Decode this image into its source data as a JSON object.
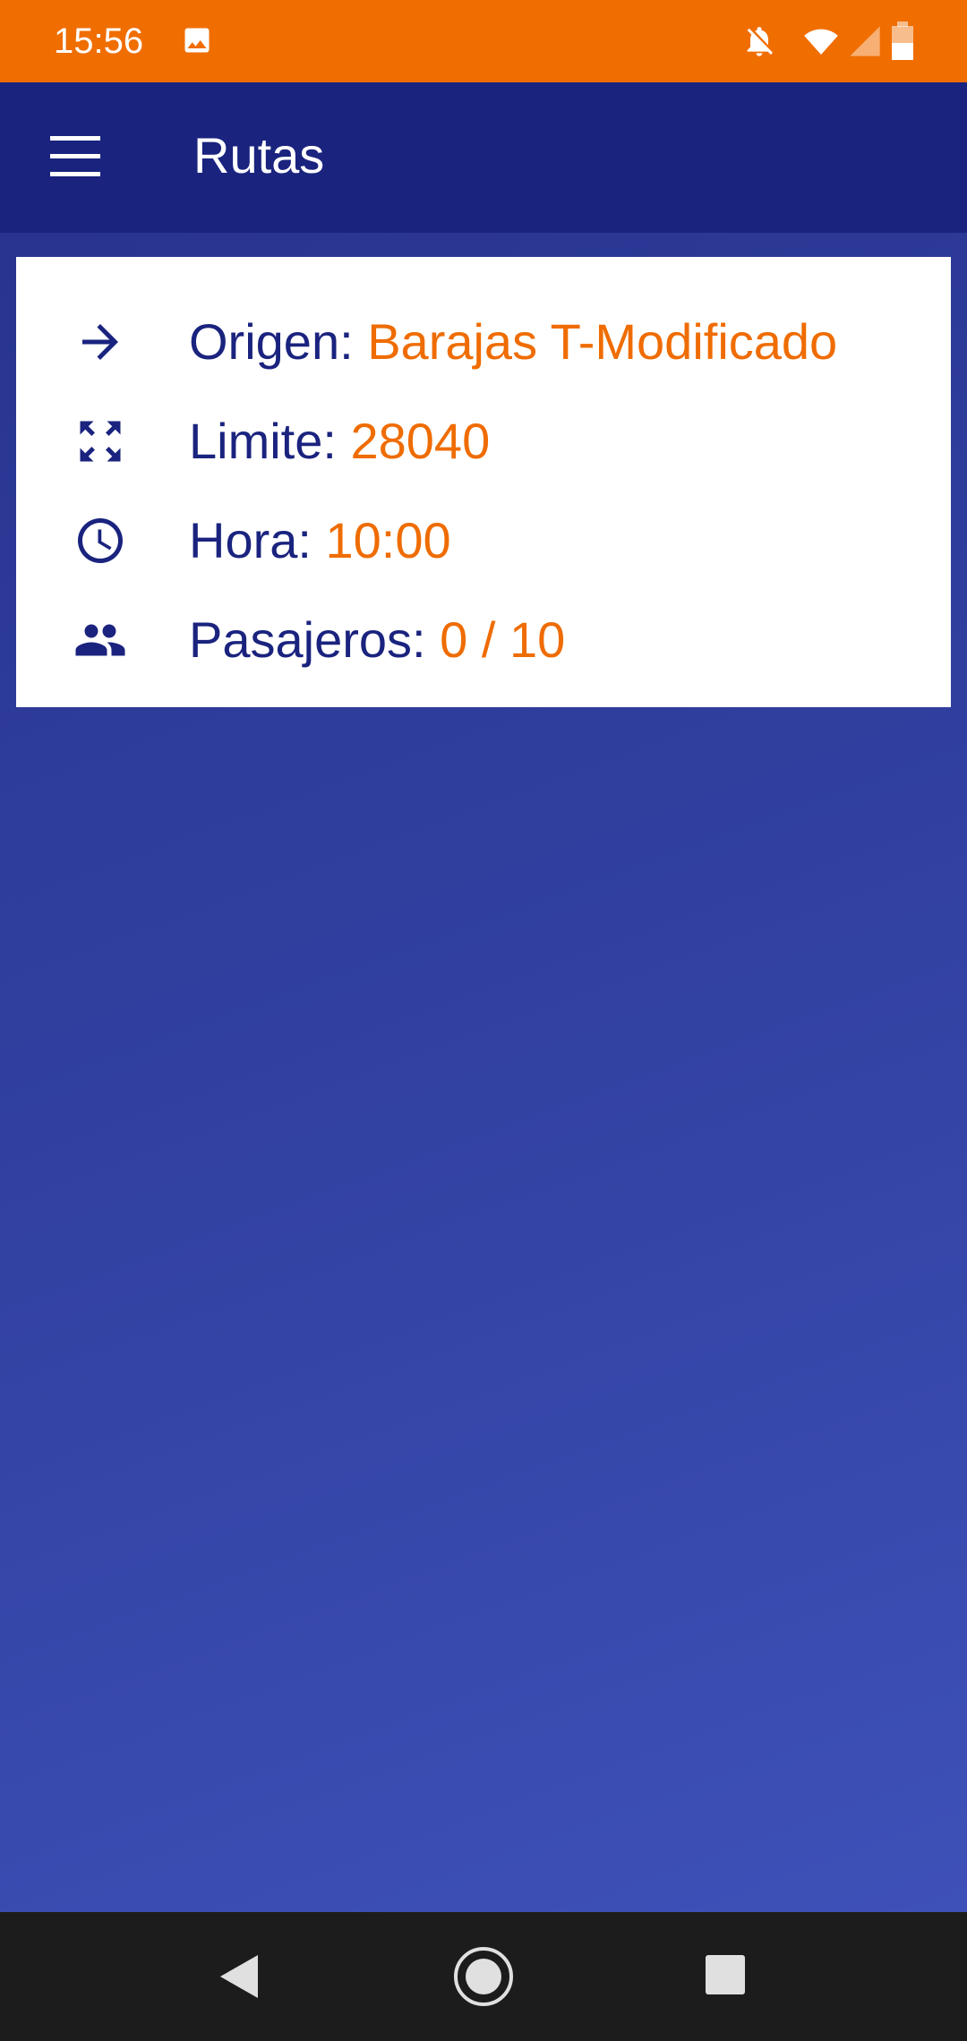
{
  "status_bar": {
    "time": "15:56",
    "icons": [
      "image-icon",
      "notifications-off-icon",
      "wifi-icon",
      "cell-signal-icon",
      "battery-icon"
    ]
  },
  "app_bar": {
    "title": "Rutas",
    "menu_icon": "menu-icon"
  },
  "route_card": {
    "rows": [
      {
        "icon": "arrow-forward-icon",
        "label": "Origen:",
        "value": "Barajas T-Modificado"
      },
      {
        "icon": "zoom-out-map-icon",
        "label": "Limite:",
        "value": "28040"
      },
      {
        "icon": "clock-icon",
        "label": "Hora:",
        "value": "10:00"
      },
      {
        "icon": "people-icon",
        "label": "Pasajeros:",
        "value": "0 / 10"
      }
    ]
  },
  "nav_bar": {
    "buttons": [
      "back-icon",
      "home-icon",
      "recents-icon"
    ]
  },
  "colors": {
    "status_bar": "#f06d00",
    "app_bar": "#1a237e",
    "label_text": "#1a237e",
    "value_text": "#ef6c00",
    "background": "#2d3a96",
    "nav_bar": "#1c1c1c"
  }
}
